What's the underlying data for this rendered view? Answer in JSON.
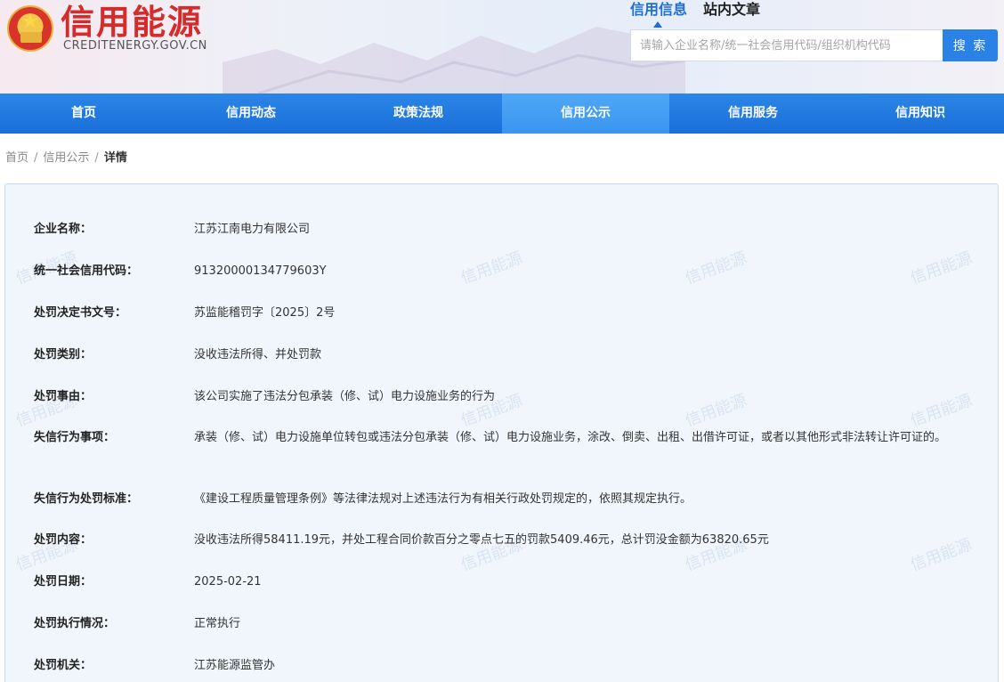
{
  "header": {
    "logo_title": "信用能源",
    "logo_domain": "CREDITENERGY.GOV.CN",
    "search_tabs": [
      "信用信息",
      "站内文章"
    ],
    "search_placeholder": "请输入企业名称/统一社会信用代码/组织机构代码",
    "search_button": "搜 索"
  },
  "nav": {
    "items": [
      "首页",
      "信用动态",
      "政策法规",
      "信用公示",
      "信用服务",
      "信用知识"
    ],
    "active_index": 3
  },
  "breadcrumb": {
    "home": "首页",
    "section": "信用公示",
    "current": "详情",
    "separator": "/"
  },
  "watermark_text": "信用能源",
  "detail": [
    {
      "label": "企业名称：",
      "value": "江苏江南电力有限公司"
    },
    {
      "label": "统一社会信用代码：",
      "value": "91320000134779603Y"
    },
    {
      "label": "处罚决定书文号：",
      "value": "苏监能稽罚字〔2025〕2号"
    },
    {
      "label": "处罚类别：",
      "value": "没收违法所得、并处罚款"
    },
    {
      "label": "处罚事由：",
      "value": "该公司实施了违法分包承装（修、试）电力设施业务的行为"
    },
    {
      "label": "失信行为事项：",
      "value": "承装（修、试）电力设施单位转包或违法分包承装（修、试）电力设施业务，涂改、倒卖、出租、出借许可证，或者以其他形式非法转让许可证的。"
    },
    {
      "label": "失信行为处罚标准：",
      "value": "《建设工程质量管理条例》等法律法规对上述违法行为有相关行政处罚规定的，依照其规定执行。"
    },
    {
      "label": "处罚内容：",
      "value": "没收违法所得58411.19元，并处工程合同价款百分之零点七五的罚款5409.46元，总计罚没金额为63820.65元"
    },
    {
      "label": "处罚日期：",
      "value": "2025-02-21"
    },
    {
      "label": "处罚执行情况：",
      "value": "正常执行"
    },
    {
      "label": "处罚机关：",
      "value": "江苏能源监管办"
    }
  ],
  "colors": {
    "brand_red": "#d52b2b",
    "nav_blue": "#1a6fd8",
    "nav_active": "#3a95ef",
    "panel_bg": "#f1f6fd"
  }
}
